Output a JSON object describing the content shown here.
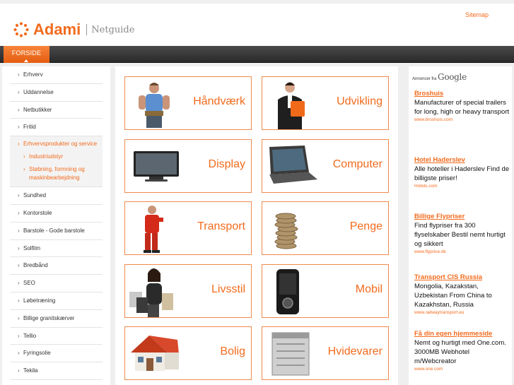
{
  "header": {
    "logo_text": "Adami",
    "logo_sub": "Netguide",
    "sitemap": "Sitemap"
  },
  "nav": {
    "tab_home": "FORSIDE"
  },
  "sidebar": {
    "items_top": [
      "Erhverv",
      "Uddannelse",
      "Netbutikker",
      "Fritid"
    ],
    "active": {
      "label": "Erhvervsprodukter og service",
      "sub": [
        "Industriudstyr",
        "Støbning, formning og maskinbearbejdning"
      ]
    },
    "items_bottom": [
      "Sundhed",
      "Kontorstole",
      "Barstole - Gode barstole",
      "Solfilm",
      "Bredbånd",
      "SEO",
      "Løbetræning",
      "Billige granitskærver",
      "Tellio",
      "Fyringsolie",
      "Tekila"
    ]
  },
  "cards": [
    {
      "label": "Håndværk",
      "icon": "worker-photo-icon"
    },
    {
      "label": "Udvikling",
      "icon": "businessman-photo-icon"
    },
    {
      "label": "Display",
      "icon": "monitor-photo-icon"
    },
    {
      "label": "Computer",
      "icon": "laptop-photo-icon"
    },
    {
      "label": "Transport",
      "icon": "mechanic-photo-icon"
    },
    {
      "label": "Penge",
      "icon": "coins-photo-icon"
    },
    {
      "label": "Livsstil",
      "icon": "shopping-woman-photo-icon"
    },
    {
      "label": "Mobil",
      "icon": "mobile-phone-photo-icon"
    },
    {
      "label": "Bolig",
      "icon": "house-photo-icon"
    },
    {
      "label": "Hvidevarer",
      "icon": "dishwasher-photo-icon"
    }
  ],
  "ads": {
    "heading_prefix": "Annoncer fra",
    "heading_brand": "Google",
    "items": [
      {
        "title": "Broshuis",
        "desc": "Manufacturer of special trailers for long, high or heavy transport",
        "url": "www.broshuis.com"
      },
      {
        "title": "Hotel Haderslev",
        "desc": "Alle hoteller i Haderslev Find de billigste priser!",
        "url": "Hotels.com"
      },
      {
        "title": "Billige Flypriser",
        "desc": "Find flypriser fra 300 flyselskaber Bestil nemt hurtigt og sikkert",
        "url": "www.flyprice.dk"
      },
      {
        "title": "Transport CIS Russia",
        "desc": "Mongolia, Kazakstan, Uzbekistan From China to Kazakhstan, Russia",
        "url": "www.railwaytransport.eu"
      },
      {
        "title": "Få din egen hjemmeside",
        "desc": "Nemt og hurtigt med One.com. 3000MB Webhotel m/Webcreator",
        "url": "www.one.com"
      }
    ]
  },
  "colors": {
    "accent": "#f26b1d",
    "nav": "#333333"
  }
}
